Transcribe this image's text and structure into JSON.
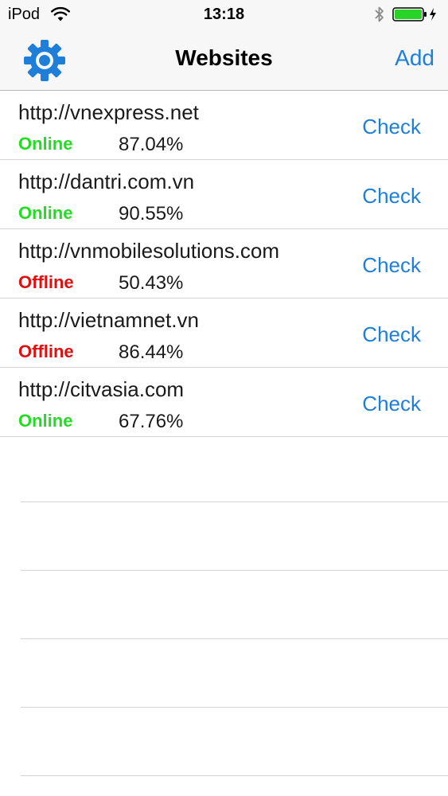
{
  "status_bar": {
    "device": "iPod",
    "time": "13:18",
    "icons": [
      "wifi-icon",
      "bluetooth-icon",
      "battery-charging-icon"
    ]
  },
  "nav": {
    "title": "Websites",
    "add_label": "Add",
    "settings_icon": "gear-icon"
  },
  "colors": {
    "accent": "#1f7fd8",
    "online": "#22dd22",
    "offline": "#e01010"
  },
  "websites": [
    {
      "url": "http://vnexpress.net",
      "status": "Online",
      "percent": "87.04%",
      "check_label": "Check"
    },
    {
      "url": "http://dantri.com.vn",
      "status": "Online",
      "percent": "90.55%",
      "check_label": "Check"
    },
    {
      "url": "http://vnmobilesolutions.com",
      "status": "Offline",
      "percent": "50.43%",
      "check_label": "Check"
    },
    {
      "url": "http://vietnamnet.vn",
      "status": "Offline",
      "percent": "86.44%",
      "check_label": "Check"
    },
    {
      "url": "http://citvasia.com",
      "status": "Online",
      "percent": "67.76%",
      "check_label": "Check"
    }
  ]
}
